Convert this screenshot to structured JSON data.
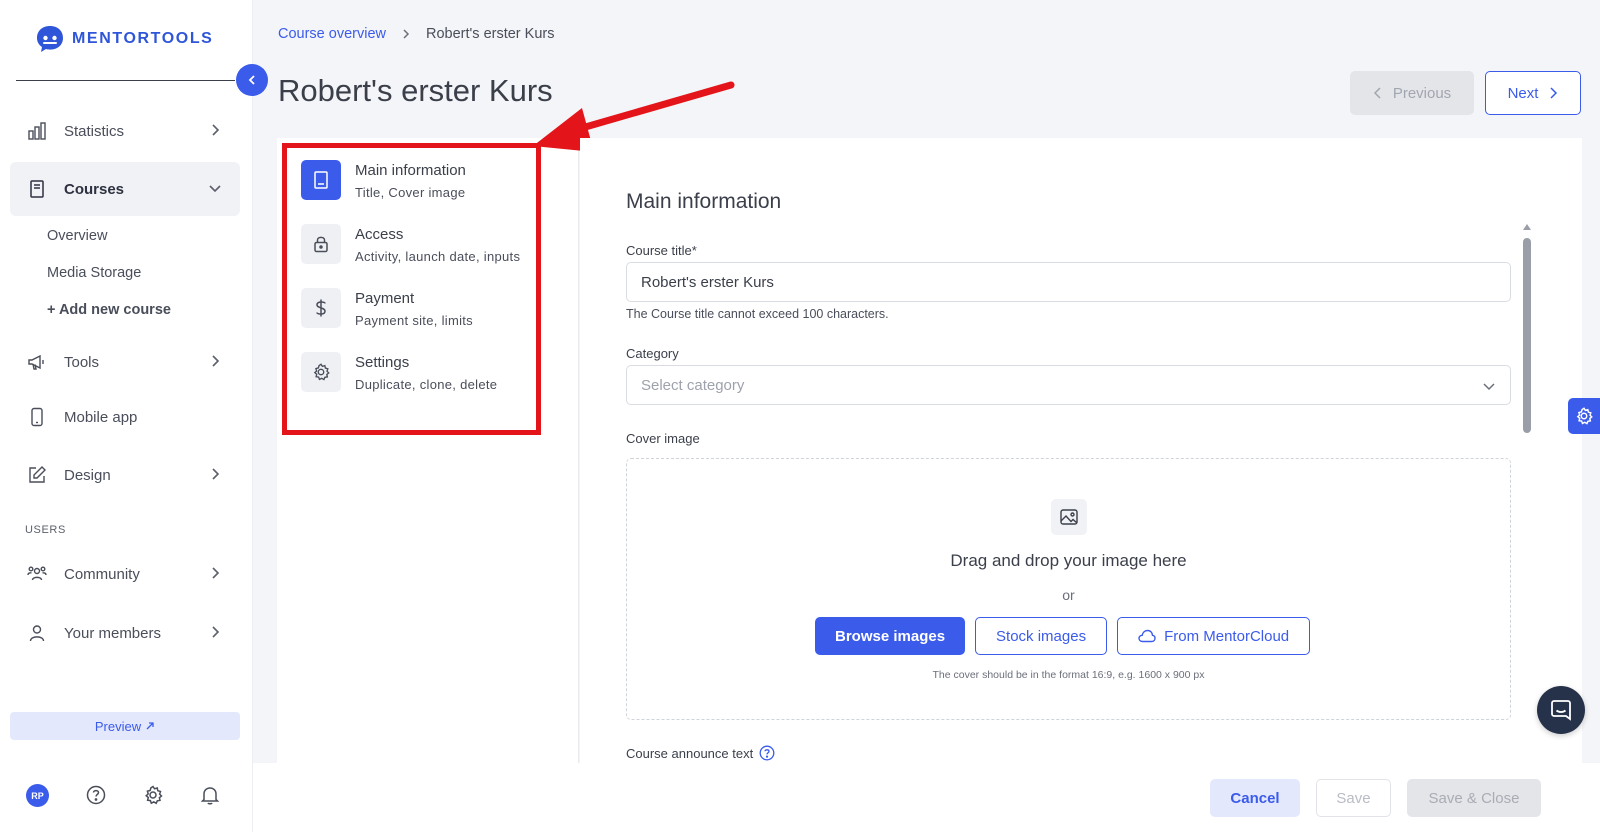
{
  "brand": {
    "name": "MENTORTOOLS",
    "accent": "#3b5bea"
  },
  "sidebar": {
    "items": [
      {
        "label": "Statistics",
        "icon": "bar-chart-icon"
      },
      {
        "label": "Courses",
        "icon": "book-icon",
        "active": true
      },
      {
        "label": "Tools",
        "icon": "megaphone-icon"
      },
      {
        "label": "Mobile app",
        "icon": "mobile-icon"
      },
      {
        "label": "Design",
        "icon": "edit-icon"
      },
      {
        "label": "Community",
        "icon": "community-icon"
      },
      {
        "label": "Your members",
        "icon": "user-icon"
      }
    ],
    "course_sub_items": [
      "Overview",
      "Media Storage",
      "+ Add new course"
    ],
    "section_label": "USERS",
    "preview_label": "Preview",
    "avatar_initials": "RP"
  },
  "header": {
    "breadcrumb": [
      "Course overview",
      "Robert's erster Kurs"
    ],
    "title": "Robert's erster Kurs",
    "previous_label": "Previous",
    "next_label": "Next"
  },
  "steps": [
    {
      "title": "Main information",
      "subtitle": "Title, Cover image",
      "icon": "book-icon",
      "active": true
    },
    {
      "title": "Access",
      "subtitle": "Activity, launch date, inputs",
      "icon": "lock-icon"
    },
    {
      "title": "Payment",
      "subtitle": "Payment site, limits",
      "icon": "dollar-icon"
    },
    {
      "title": "Settings",
      "subtitle": "Duplicate, clone, delete",
      "icon": "gear-icon"
    }
  ],
  "form": {
    "section_title": "Main information",
    "course_title_label": "Course title*",
    "course_title_value": "Robert's erster Kurs",
    "course_title_helper": "The Course title cannot exceed 100 characters.",
    "category_label": "Category",
    "category_placeholder": "Select category",
    "cover_label": "Cover image",
    "dropzone_title": "Drag and drop your image here",
    "dropzone_or": "or",
    "browse_label": "Browse images",
    "stock_label": "Stock images",
    "cloud_label": "From MentorCloud",
    "cover_hint": "The cover should be in the format 16:9, e.g. 1600 x 900 px",
    "announce_label": "Course announce text"
  },
  "footer": {
    "cancel_label": "Cancel",
    "save_label": "Save",
    "save_close_label": "Save & Close"
  },
  "annotation": {
    "highlight_color": "#e3151a"
  }
}
